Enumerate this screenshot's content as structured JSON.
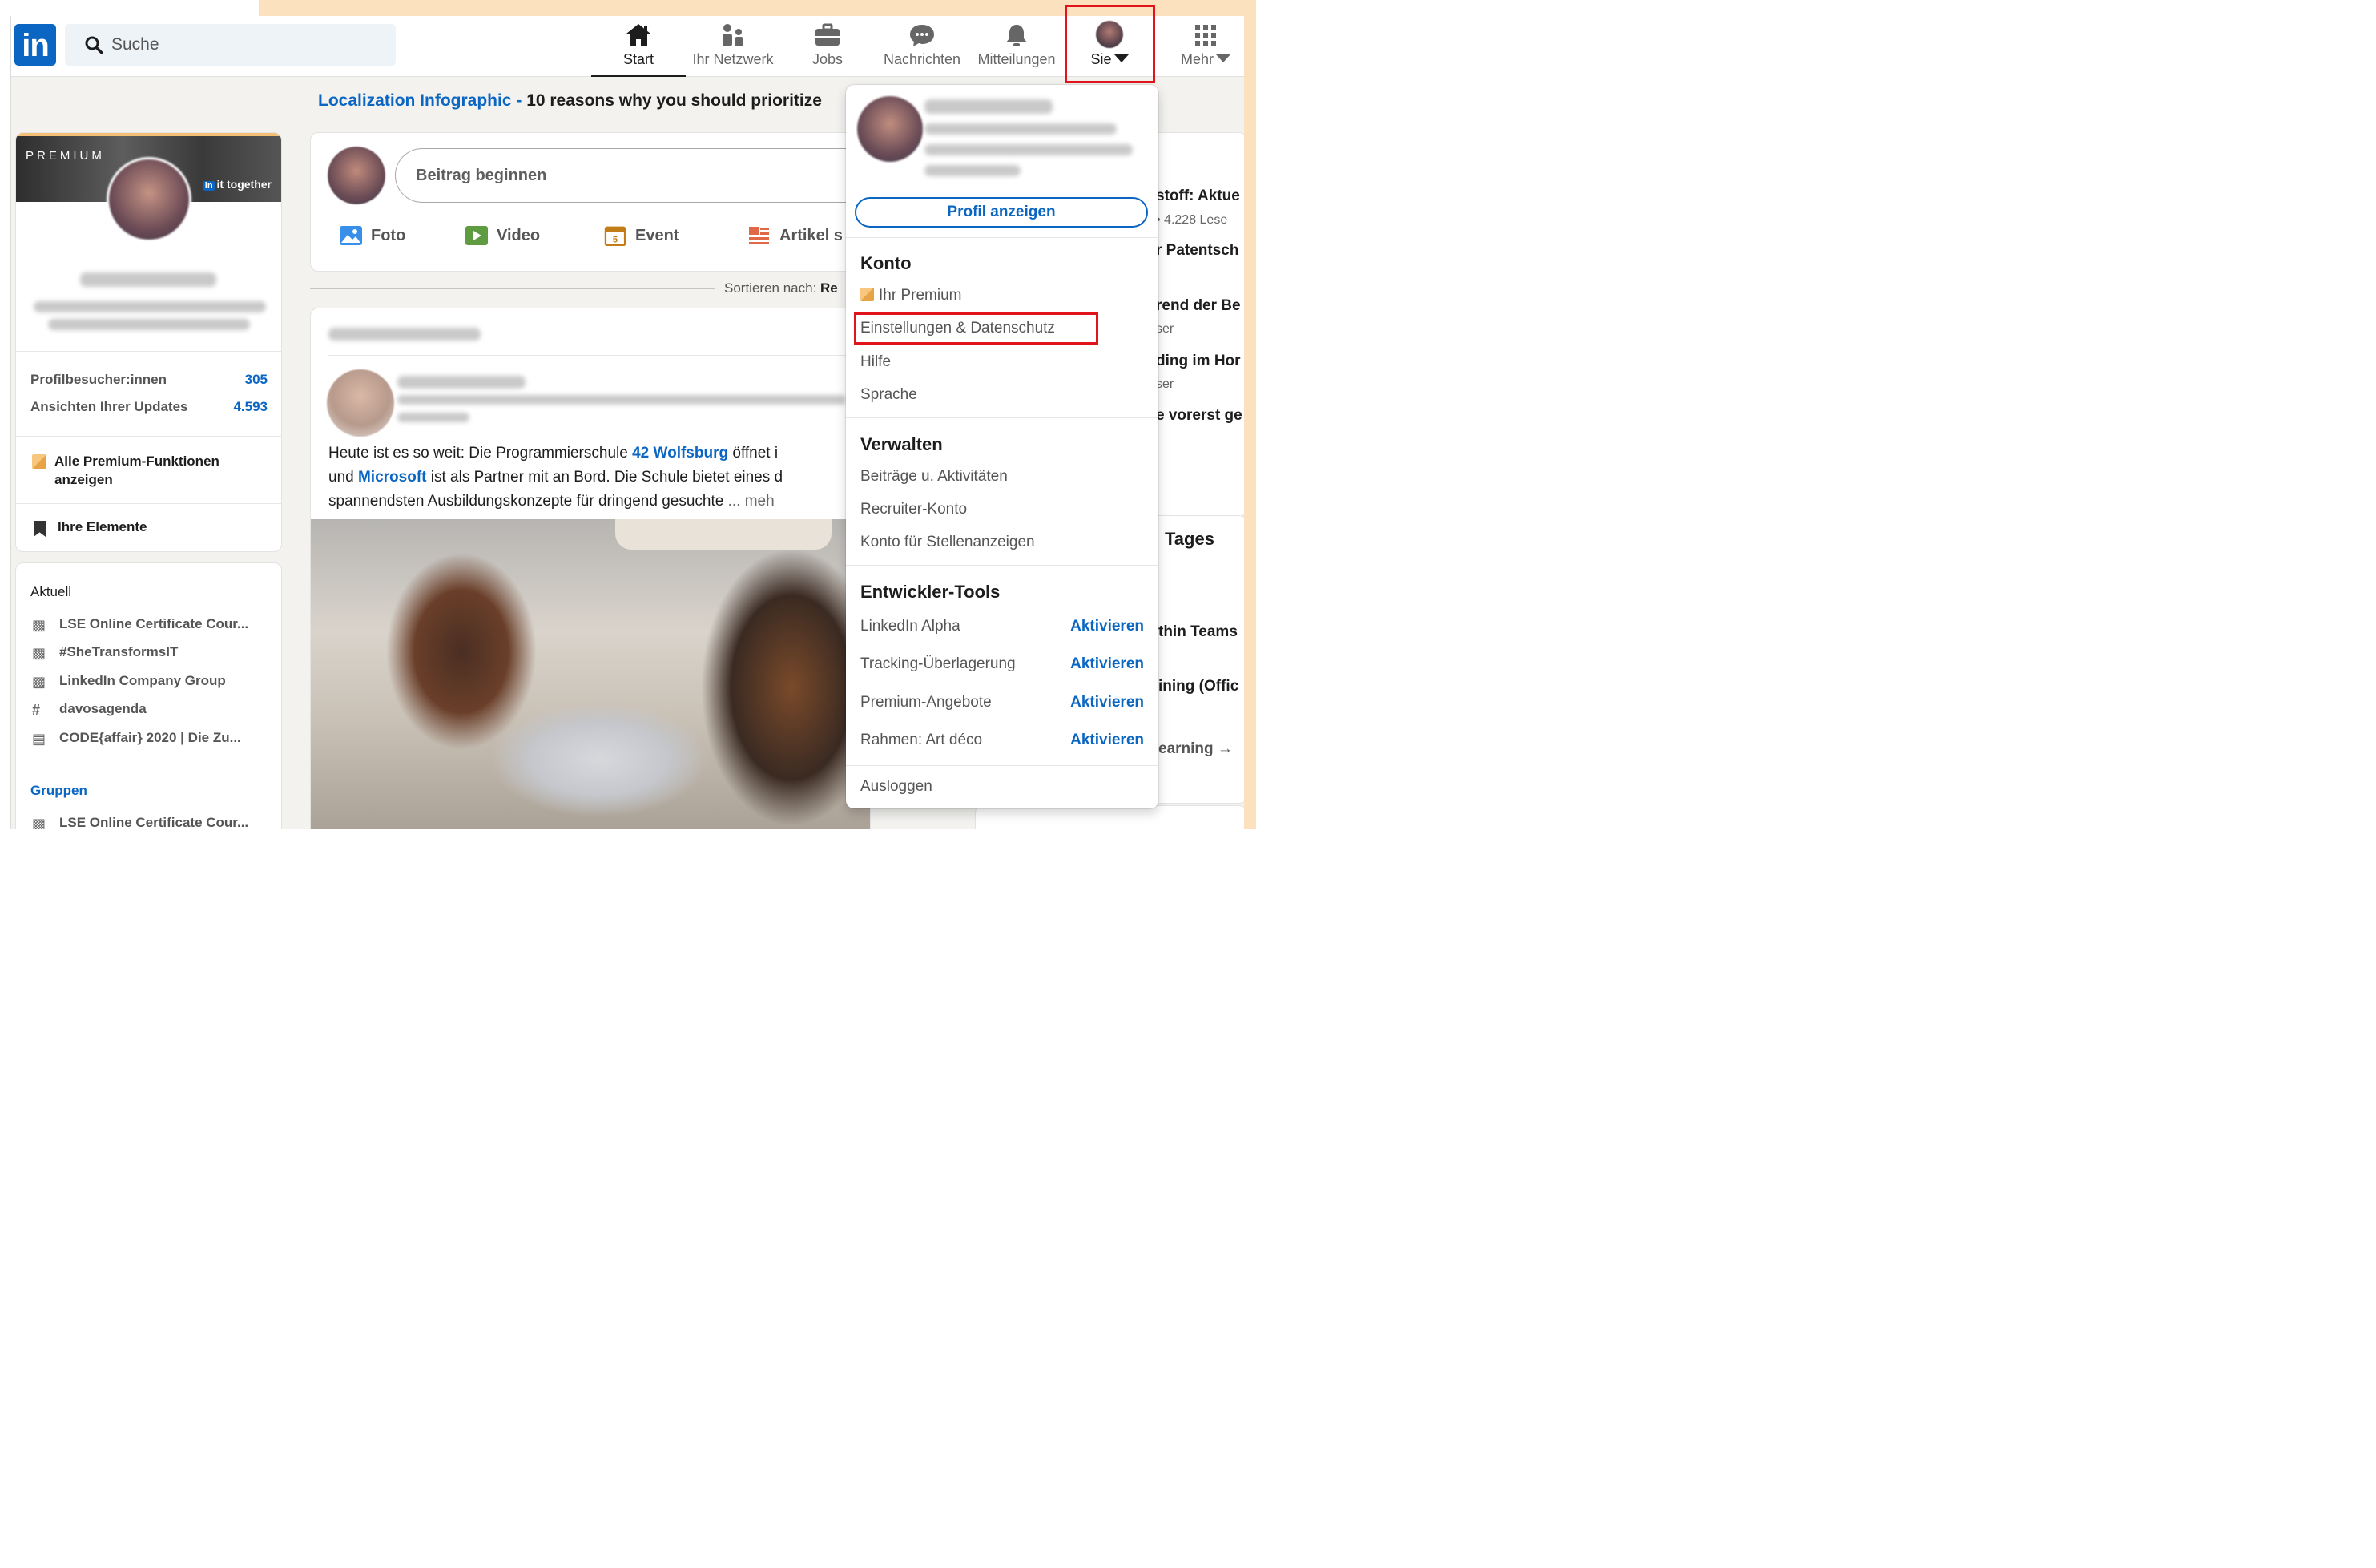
{
  "nav": {
    "logo": "in",
    "search_placeholder": "Suche",
    "items": [
      {
        "label": "Start"
      },
      {
        "label": "Ihr Netzwerk"
      },
      {
        "label": "Jobs"
      },
      {
        "label": "Nachrichten"
      },
      {
        "label": "Mitteilungen"
      },
      {
        "label": "Sie"
      },
      {
        "label": "Mehr"
      }
    ]
  },
  "banner": {
    "link": "Localization Infographic -",
    "text": "10 reasons why you should prioritize"
  },
  "profile_card": {
    "premium_label": "PREMIUM",
    "together": "it together",
    "together_logo": "in",
    "stats": [
      {
        "label": "Profilbesucher:innen",
        "value": "305"
      },
      {
        "label": "Ansichten Ihrer Updates",
        "value": "4.593"
      }
    ],
    "premium_link": "Alle Premium-Funktionen anzeigen",
    "elements": "Ihre Elemente"
  },
  "recent": {
    "title": "Aktuell",
    "items": [
      {
        "icon": "group-icon",
        "label": "LSE Online Certificate Cour..."
      },
      {
        "icon": "group-icon",
        "label": "#SheTransformsIT"
      },
      {
        "icon": "group-icon",
        "label": "LinkedIn Company Group"
      },
      {
        "icon": "hashtag-icon",
        "label": "davosagenda"
      },
      {
        "icon": "event-icon",
        "label": "CODE{affair} 2020 | Die Zu..."
      }
    ],
    "groups_label": "Gruppen",
    "group_items": [
      {
        "icon": "group-icon",
        "label": "LSE Online Certificate Cour..."
      }
    ]
  },
  "share": {
    "placeholder": "Beitrag beginnen",
    "buttons": [
      {
        "label": "Foto"
      },
      {
        "label": "Video"
      },
      {
        "label": "Event"
      },
      {
        "label": "Artikel s"
      }
    ],
    "event_day": "5"
  },
  "sort": {
    "label": "Sortieren nach:",
    "value": "Re"
  },
  "post": {
    "text_1": "Heute ist es so weit: Die Programmierschule ",
    "link_1": "42 Wolfsburg",
    "text_2": " öffnet i",
    "text_3": "und ",
    "link_2": "Microsoft",
    "text_4": " ist als Partner mit an Bord. Die Schule bietet eines d",
    "text_5": "spannendsten Ausbildungskonzepte für dringend gesuchte",
    "more": " ... meh"
  },
  "right": {
    "lines": [
      {
        "text": "stoff: Aktue",
        "style": "title"
      },
      {
        "text": "• 4.228 Lese",
        "style": "sub"
      },
      {
        "text": "r Patentsch",
        "style": "title"
      },
      {
        "text": "rend der Be",
        "style": "title"
      },
      {
        "text": "ser",
        "style": "sub"
      },
      {
        "text": "ding im Hor",
        "style": "title"
      },
      {
        "text": "ser",
        "style": "sub"
      },
      {
        "text": "e vorerst ge",
        "style": "title"
      }
    ],
    "section2_title": "Tages",
    "lines2": [
      {
        "text": "thin Teams"
      },
      {
        "text": "ining (Offic"
      },
      {
        "text": "earning →"
      }
    ]
  },
  "dropdown": {
    "profile_button": "Profil anzeigen",
    "konto": "Konto",
    "premium": "Ihr Premium",
    "settings": "Einstellungen & Datenschutz",
    "help": "Hilfe",
    "language": "Sprache",
    "manage": "Verwalten",
    "manage_items": [
      "Beiträge u. Aktivitäten",
      "Recruiter-Konto",
      "Konto für Stellenanzeigen"
    ],
    "dev_tools": "Entwickler-Tools",
    "dev_items": [
      {
        "label": "LinkedIn Alpha",
        "action": "Aktivieren"
      },
      {
        "label": "Tracking-Überlagerung",
        "action": "Aktivieren"
      },
      {
        "label": "Premium-Angebote",
        "action": "Aktivieren"
      },
      {
        "label": "Rahmen: Art déco",
        "action": "Aktivieren"
      }
    ],
    "logout": "Ausloggen"
  },
  "colors": {
    "brand": "#0a66c2",
    "highlight": "#e0141a",
    "accent_bg": "#fbe1bd"
  }
}
